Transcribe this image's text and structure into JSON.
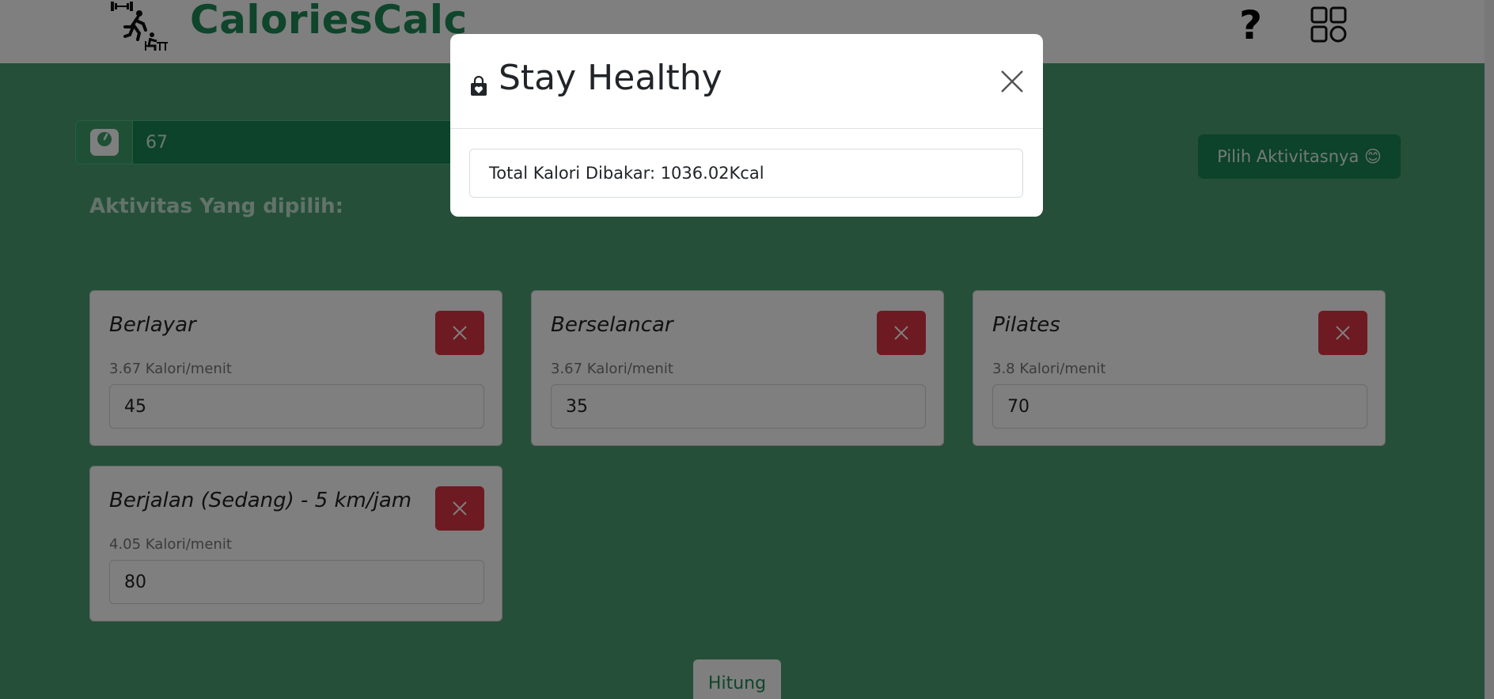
{
  "app": {
    "brand": "CaloriesCalc",
    "help_label": "?",
    "icons": {
      "logo": "fitness-figures-logo",
      "help": "question-mark-icon",
      "menu": "grid-icon",
      "weight": "scale-icon",
      "remove": "close-icon"
    }
  },
  "weight": {
    "value": "67"
  },
  "pick_button": {
    "label": "Pilih Aktivitasnya 😊"
  },
  "selected_heading": "Aktivitas Yang dipilih:",
  "activities": [
    {
      "name": "Berlayar",
      "rate": "3.67 Kalori/menit",
      "minutes": "45"
    },
    {
      "name": "Berselancar",
      "rate": "3.67 Kalori/menit",
      "minutes": "35"
    },
    {
      "name": "Pilates",
      "rate": "3.8 Kalori/menit",
      "minutes": "70"
    },
    {
      "name": "Berjalan (Sedang) - 5 km/jam",
      "rate": "4.05 Kalori/menit",
      "minutes": "80"
    }
  ],
  "hitung_button": {
    "label": "Hitung"
  },
  "modal": {
    "title": "Stay Healthy",
    "title_icon": "shopping-bag-heart-icon",
    "close_icon": "close-icon",
    "result_text": "Total Kalori Dibakar: 1036.02Kcal"
  },
  "colors": {
    "brand_green": "#1f8a57",
    "button_green": "#198754",
    "page_green": "#4a9e73",
    "danger_red": "#dc3545",
    "backdrop": "rgba(0,0,0,0.5)"
  }
}
